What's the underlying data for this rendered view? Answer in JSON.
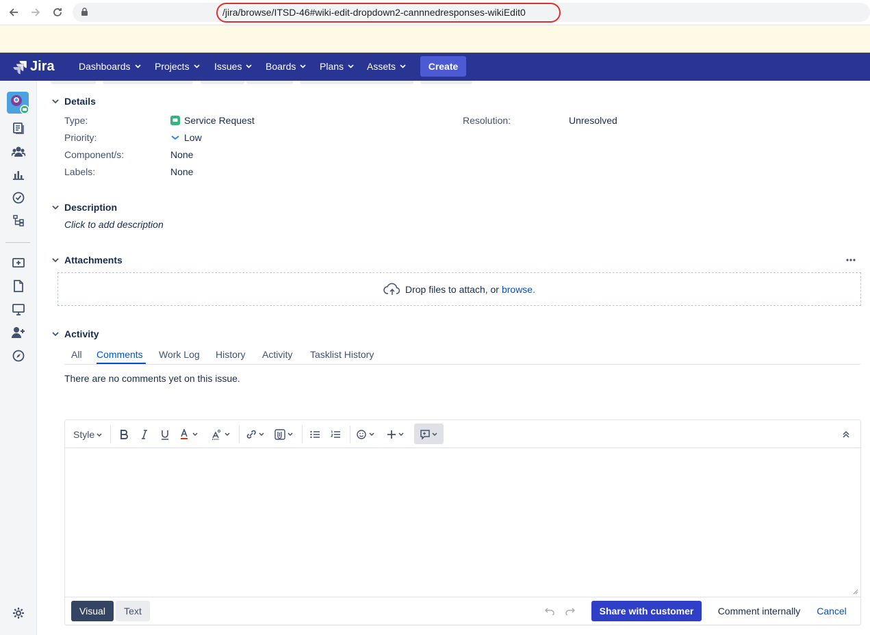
{
  "browser": {
    "url": "/jira/browse/ITSD-46#wiki-edit-dropdown2-cannnedresponses-wikiEdit0"
  },
  "nav": {
    "logo": "Jira",
    "items": [
      {
        "label": "Dashboards"
      },
      {
        "label": "Projects"
      },
      {
        "label": "Issues"
      },
      {
        "label": "Boards"
      },
      {
        "label": "Plans"
      },
      {
        "label": "Assets"
      }
    ],
    "create": "Create"
  },
  "details": {
    "heading": "Details",
    "type_label": "Type:",
    "type_value": "Service Request",
    "priority_label": "Priority:",
    "priority_value": "Low",
    "component_label": "Component/s:",
    "component_value": "None",
    "labels_label": "Labels:",
    "labels_value": "None",
    "resolution_label": "Resolution:",
    "resolution_value": "Unresolved"
  },
  "description": {
    "heading": "Description",
    "placeholder": "Click to add description"
  },
  "attachments": {
    "heading": "Attachments",
    "drop_text": "Drop files to attach, or",
    "browse_link": "browse."
  },
  "activity": {
    "heading": "Activity",
    "tabs": [
      "All",
      "Comments",
      "Work Log",
      "History",
      "Activity",
      "Tasklist History"
    ],
    "active_tab": "Comments",
    "empty_text": "There are no comments yet on this issue."
  },
  "editor": {
    "style_label": "Style",
    "mode_visual": "Visual",
    "mode_text": "Text",
    "share_button": "Share with customer",
    "internal_button": "Comment internally",
    "cancel_button": "Cancel"
  },
  "colors": {
    "nav_bg": "#283593",
    "create_bg": "#4c5bd4",
    "share_bg": "#2f3fc7",
    "link": "#0052cc",
    "url_highlight": "#e0302b"
  }
}
